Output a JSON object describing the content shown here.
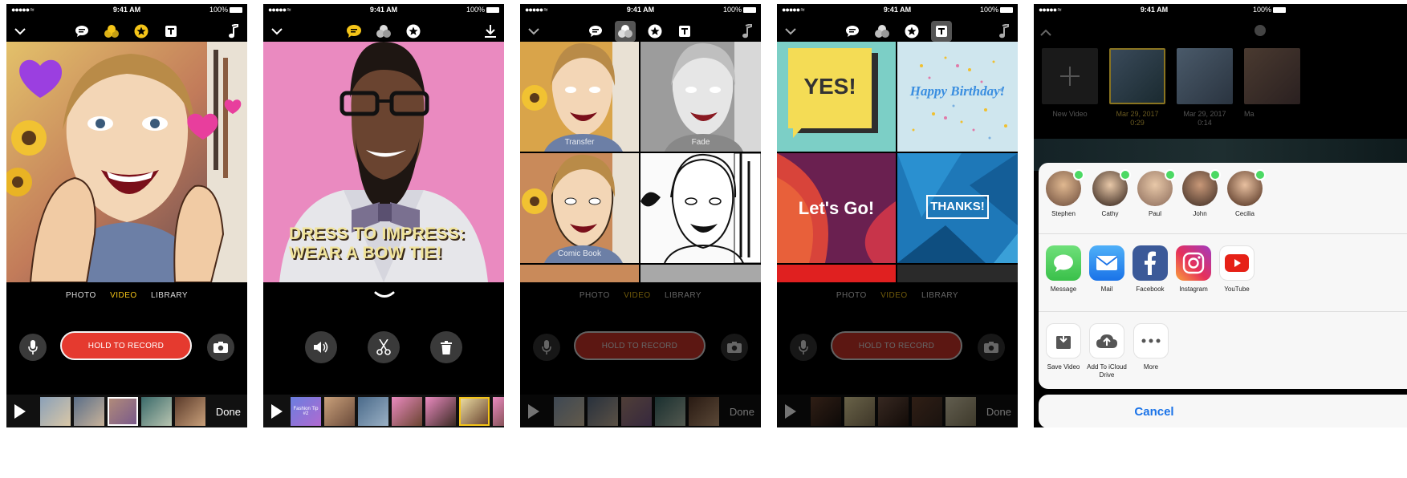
{
  "status": {
    "time": "9:41 AM",
    "battery": "100%"
  },
  "modes": [
    "PHOTO",
    "VIDEO",
    "LIBRARY"
  ],
  "record": {
    "label": "HOLD TO RECORD"
  },
  "filmstrip": {
    "done": "Done"
  },
  "screen2": {
    "overlay_line1": "DRESS TO IMPRESS:",
    "overlay_line2": "WEAR A BOW TIE!",
    "thumb_label": "Fashion Tip #2"
  },
  "screen3": {
    "filters": [
      "Transfer",
      "Fade",
      "Comic Book",
      ""
    ]
  },
  "screen4": {
    "stickers": [
      "YES!",
      "Happy Birthday!",
      "Let's Go!",
      "THANKS!"
    ]
  },
  "screen5": {
    "library": {
      "new_video": "New Video",
      "items": [
        {
          "date": "Mar 29, 2017",
          "duration": "0:29"
        },
        {
          "date": "Mar 29, 2017",
          "duration": "0:14"
        },
        {
          "date": "Ma",
          "duration": ""
        }
      ]
    },
    "people": [
      "Stephen",
      "Cathy",
      "Paul",
      "John",
      "Cecilia"
    ],
    "apps": [
      "Message",
      "Mail",
      "Facebook",
      "Instagram",
      "YouTube"
    ],
    "actions": [
      "Save Video",
      "Add To iCloud Drive",
      "More"
    ],
    "cancel": "Cancel"
  },
  "colors": {
    "accent_yellow": "#f5c518",
    "record_red": "#e53a2f",
    "ios_blue": "#1a73e8",
    "online_green": "#4cd964"
  }
}
